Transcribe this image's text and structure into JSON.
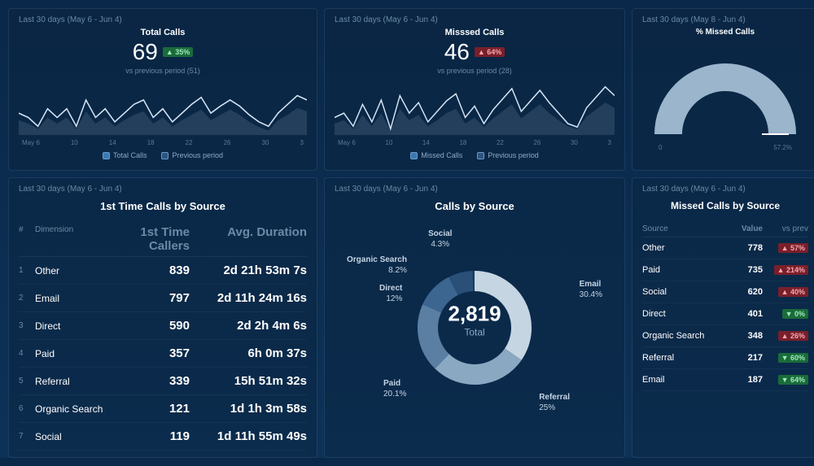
{
  "dateRange30": "Last 30 days (May 6 - Jun 4)",
  "dateRange30b": "Last 30 days (May 8 - Jun 4)",
  "totalCalls": {
    "title": "Total Calls",
    "value": "69",
    "delta": "▲ 35%",
    "deltaDir": "up",
    "sub": "vs previous period (51)",
    "legend1": "Total Calls",
    "legend2": "Previous period",
    "ticks": [
      "May 6",
      "10",
      "14",
      "18",
      "22",
      "26",
      "30",
      "3"
    ]
  },
  "missedCalls": {
    "title": "Misssed Calls",
    "value": "46",
    "delta": "▲ 64%",
    "deltaDir": "down",
    "sub": "vs previous period (28)",
    "legend1": "Missed Calls",
    "legend2": "Previous period",
    "ticks": [
      "May 6",
      "10",
      "14",
      "18",
      "22",
      "26",
      "30",
      "3"
    ]
  },
  "gauge": {
    "title": "% Missed Calls",
    "min": "0",
    "max": "57.2%"
  },
  "firstTime": {
    "title": "1st Time Calls by Source",
    "headers": {
      "n": "#",
      "d": "Dimension",
      "v": "1st Time Callers",
      "t": "Avg. Duration"
    },
    "rows": [
      {
        "n": "1",
        "d": "Other",
        "v": "839",
        "t": "2d 21h 53m 7s"
      },
      {
        "n": "2",
        "d": "Email",
        "v": "797",
        "t": "2d 11h 24m 16s"
      },
      {
        "n": "3",
        "d": "Direct",
        "v": "590",
        "t": "2d 2h 4m 6s"
      },
      {
        "n": "4",
        "d": "Paid",
        "v": "357",
        "t": "6h 0m 37s"
      },
      {
        "n": "5",
        "d": "Referral",
        "v": "339",
        "t": "15h 51m 32s"
      },
      {
        "n": "6",
        "d": "Organic Search",
        "v": "121",
        "t": "1d 1h 3m 58s"
      },
      {
        "n": "7",
        "d": "Social",
        "v": "119",
        "t": "1d 11h 55m 49s"
      }
    ]
  },
  "callsBySource": {
    "title": "Calls by Source",
    "total": "2,819",
    "totalLabel": "Total",
    "slices": [
      {
        "name": "Email",
        "pct": "30.4%"
      },
      {
        "name": "Referral",
        "pct": "25%"
      },
      {
        "name": "Paid",
        "pct": "20.1%"
      },
      {
        "name": "Direct",
        "pct": "12%"
      },
      {
        "name": "Organic Search",
        "pct": "8.2%"
      },
      {
        "name": "Social",
        "pct": "4.3%"
      }
    ]
  },
  "missedBySource": {
    "title": "Missed Calls by Source",
    "headers": {
      "s": "Source",
      "v": "Value",
      "p": "vs prev"
    },
    "rows": [
      {
        "s": "Other",
        "v": "778",
        "p": "▲ 57%",
        "dir": "down"
      },
      {
        "s": "Paid",
        "v": "735",
        "p": "▲ 214%",
        "dir": "down"
      },
      {
        "s": "Social",
        "v": "620",
        "p": "▲ 40%",
        "dir": "down"
      },
      {
        "s": "Direct",
        "v": "401",
        "p": "▼ 0%",
        "dir": "up"
      },
      {
        "s": "Organic Search",
        "v": "348",
        "p": "▲ 26%",
        "dir": "down"
      },
      {
        "s": "Referral",
        "v": "217",
        "p": "▼ 60%",
        "dir": "up"
      },
      {
        "s": "Email",
        "v": "187",
        "p": "▼ 64%",
        "dir": "up"
      }
    ]
  },
  "chart_data": [
    {
      "type": "line",
      "title": "Total Calls",
      "x": [
        "May 6",
        "10",
        "14",
        "18",
        "22",
        "26",
        "30",
        "Jun 3"
      ],
      "series": [
        {
          "name": "Total Calls",
          "values": [
            40,
            50,
            30,
            60,
            40,
            60,
            30,
            70,
            50,
            60,
            40,
            50,
            60,
            70,
            50,
            60,
            40,
            50,
            60,
            70,
            50,
            60,
            70,
            60,
            50,
            40,
            30,
            50,
            60,
            69
          ]
        },
        {
          "name": "Previous period",
          "values": [
            35,
            45,
            25,
            50,
            30,
            50,
            25,
            60,
            45,
            55,
            35,
            45,
            55,
            60,
            40,
            50,
            35,
            45,
            50,
            60,
            45,
            55,
            60,
            50,
            40,
            35,
            25,
            45,
            55,
            51
          ]
        }
      ]
    },
    {
      "type": "line",
      "title": "Missed Calls",
      "x": [
        "May 6",
        "10",
        "14",
        "18",
        "22",
        "26",
        "30",
        "Jun 3"
      ],
      "series": [
        {
          "name": "Missed Calls",
          "values": [
            30,
            40,
            20,
            45,
            25,
            50,
            20,
            55,
            40,
            50,
            30,
            40,
            50,
            55,
            35,
            45,
            30,
            40,
            50,
            60,
            45,
            55,
            60,
            50,
            40,
            30,
            25,
            45,
            55,
            46
          ]
        },
        {
          "name": "Previous period",
          "values": [
            25,
            30,
            18,
            35,
            20,
            40,
            15,
            45,
            30,
            40,
            25,
            30,
            40,
            45,
            28,
            35,
            25,
            30,
            40,
            48,
            35,
            45,
            50,
            40,
            32,
            25,
            20,
            35,
            45,
            28
          ]
        }
      ]
    },
    {
      "type": "gauge",
      "title": "% Missed Calls",
      "value": 66.7,
      "min": 0,
      "max": 57.2
    },
    {
      "type": "pie",
      "title": "Calls by Source",
      "total": 2819,
      "series": [
        {
          "name": "Email",
          "value": 30.4
        },
        {
          "name": "Referral",
          "value": 25
        },
        {
          "name": "Paid",
          "value": 20.1
        },
        {
          "name": "Direct",
          "value": 12
        },
        {
          "name": "Organic Search",
          "value": 8.2
        },
        {
          "name": "Social",
          "value": 4.3
        }
      ]
    },
    {
      "type": "table",
      "title": "1st Time Calls by Source",
      "rows": [
        [
          "Other",
          839,
          "2d 21h 53m 7s"
        ],
        [
          "Email",
          797,
          "2d 11h 24m 16s"
        ],
        [
          "Direct",
          590,
          "2d 2h 4m 6s"
        ],
        [
          "Paid",
          357,
          "6h 0m 37s"
        ],
        [
          "Referral",
          339,
          "15h 51m 32s"
        ],
        [
          "Organic Search",
          121,
          "1d 1h 3m 58s"
        ],
        [
          "Social",
          119,
          "1d 11h 55m 49s"
        ]
      ]
    },
    {
      "type": "table",
      "title": "Missed Calls by Source",
      "rows": [
        [
          "Other",
          778,
          57
        ],
        [
          "Paid",
          735,
          214
        ],
        [
          "Social",
          620,
          40
        ],
        [
          "Direct",
          401,
          0
        ],
        [
          "Organic Search",
          348,
          26
        ],
        [
          "Referral",
          217,
          -60
        ],
        [
          "Email",
          187,
          -64
        ]
      ]
    }
  ]
}
